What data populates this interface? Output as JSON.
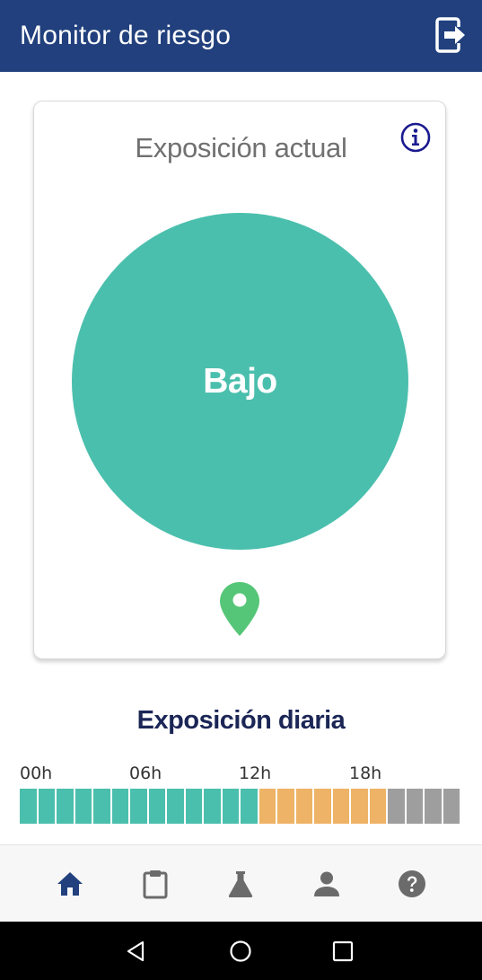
{
  "appbar": {
    "title": "Monitor de riesgo",
    "action_icon": "logout-icon"
  },
  "card": {
    "title": "Exposición actual",
    "info_icon": "info-icon",
    "risk_level": "Bajo",
    "location_icon": "location-pin-icon"
  },
  "daily": {
    "title": "Exposición diaria",
    "hour_labels": [
      "00h",
      "06h",
      "12h",
      "18h"
    ],
    "slots": [
      "low",
      "low",
      "low",
      "low",
      "low",
      "low",
      "low",
      "low",
      "low",
      "low",
      "low",
      "low",
      "low",
      "medium",
      "medium",
      "medium",
      "medium",
      "medium",
      "medium",
      "medium",
      "none",
      "none",
      "none",
      "none"
    ]
  },
  "colors": {
    "appbar": "#21407d",
    "low": "#4bbfad",
    "medium": "#eeb366",
    "none": "#9e9e9e",
    "pin": "#55c677",
    "nav_active": "#21407d",
    "nav_inactive": "#6b6b6b"
  },
  "bottom_nav": {
    "items": [
      {
        "icon": "home-icon",
        "active": true
      },
      {
        "icon": "clipboard-icon",
        "active": false
      },
      {
        "icon": "flask-icon",
        "active": false
      },
      {
        "icon": "person-icon",
        "active": false
      },
      {
        "icon": "help-icon",
        "active": false
      }
    ]
  },
  "system_nav": {
    "items": [
      "back-icon",
      "home-circle-icon",
      "recents-icon"
    ]
  }
}
